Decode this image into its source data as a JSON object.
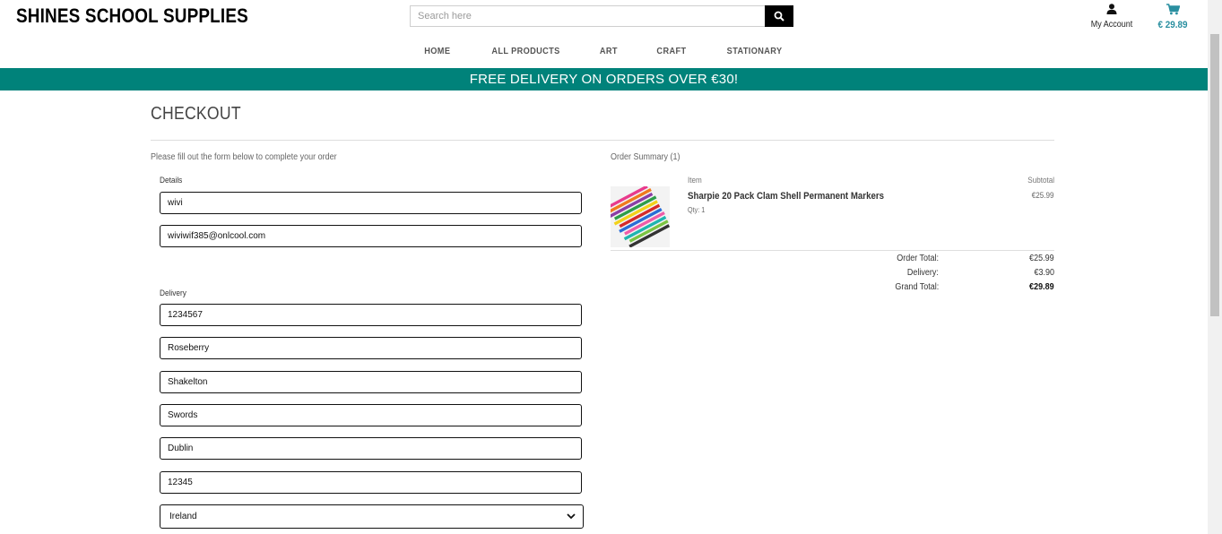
{
  "header": {
    "logo": "SHINES SCHOOL SUPPLIES",
    "search_placeholder": "Search here",
    "account_label": "My Account",
    "cart_total": "€ 29.89"
  },
  "nav": {
    "items": [
      "HOME",
      "ALL PRODUCTS",
      "ART",
      "CRAFT",
      "STATIONARY"
    ]
  },
  "banner": "FREE DELIVERY ON ORDERS OVER €30!",
  "page_title": "CHECKOUT",
  "form": {
    "intro": "Please fill out the form below to complete your order",
    "details_legend": "Details",
    "full_name": "wivi",
    "email": "wiviwif385@onlcool.com",
    "delivery_legend": "Delivery",
    "phone": "1234567",
    "street1": "Roseberry",
    "street2": "Shakelton",
    "town": "Swords",
    "county": "Dublin",
    "postcode": "12345",
    "country": "Ireland"
  },
  "summary": {
    "title": "Order Summary (1)",
    "col_item": "Item",
    "col_subtotal": "Subtotal",
    "product_name": "Sharpie 20 Pack Clam Shell Permanent Markers",
    "product_qty": "Qty: 1",
    "product_subtotal": "€25.99",
    "order_total_label": "Order Total:",
    "order_total": "€25.99",
    "delivery_label": "Delivery:",
    "delivery": "€3.90",
    "grand_total_label": "Grand Total:",
    "grand_total": "€29.89"
  },
  "colors": {
    "banner": "#00827a",
    "cart_accent": "#2a8fa0"
  }
}
